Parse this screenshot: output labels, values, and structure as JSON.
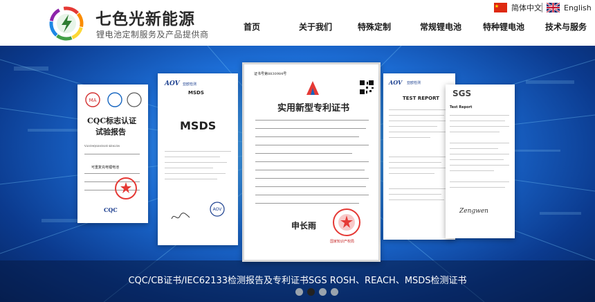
{
  "brand": {
    "name": "七色光新能源",
    "slogan": "锂电池定制服务及产品提供商"
  },
  "language": {
    "chinese": "简体中文",
    "english": "English"
  },
  "nav": {
    "items": [
      "首页",
      "关于我们",
      "特殊定制",
      "常规锂电池",
      "特种锂电池",
      "技术与服务"
    ]
  },
  "banner": {
    "caption": "CQC/CB证书/IEC62133检测报告及专利证书SGS ROSH、REACH、MSDS检测证书",
    "slide_count": 4,
    "active_slide": 2,
    "certificates": {
      "cqc": {
        "title": "CQC标志认证",
        "subtitle": "试验报告",
        "report_no": "V2019Q0301031-410218",
        "product": "可重复充电锂电池",
        "footer_logo": "CQC"
      },
      "msds": {
        "brand": "AOV",
        "brand_cn": "亚欧检测",
        "title": "MSDS",
        "big_title": "MSDS"
      },
      "patent": {
        "number": "证书号第8830984号",
        "title": "实用新型专利证书",
        "seal": "国家知识产权局",
        "signature": "申长雨"
      },
      "test_report": {
        "brand": "AOV",
        "brand_cn": "亚欧检测",
        "title": "TEST REPORT"
      },
      "sgs": {
        "logo": "SGS",
        "heading": "Test Report",
        "signature": "Zengwen"
      }
    }
  }
}
